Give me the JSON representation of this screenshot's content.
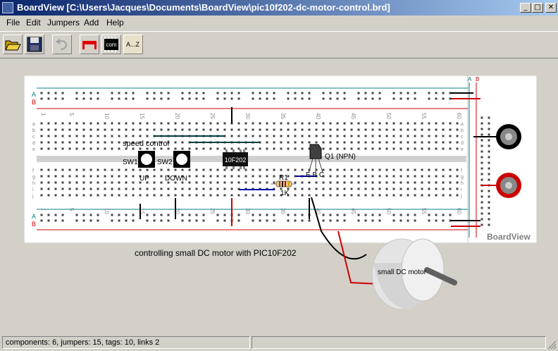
{
  "window": {
    "title": "BoardView  [C:\\Users\\Jacques\\Documents\\BoardView\\pic10f202-dc-motor-control.brd]",
    "minimize_glyph": "_",
    "maximize_glyph": "□",
    "close_glyph": "✕"
  },
  "menu": [
    {
      "label": "File"
    },
    {
      "label": "Edit"
    },
    {
      "label": "Jumpers"
    },
    {
      "label": "Add"
    },
    {
      "label": "Help"
    }
  ],
  "toolbar": {
    "open_icon": "open-folder-icon",
    "save_icon": "save-disk-icon",
    "undo_icon": "undo-icon",
    "jumper_icon": "red-jumper-icon",
    "chip_label": "com",
    "labels_label": "A...Z"
  },
  "board": {
    "rail_top": [
      "A",
      "B"
    ],
    "rail_bottom": [
      "A",
      "B"
    ],
    "rows_top": [
      "a",
      "b",
      "c",
      "d",
      "e"
    ],
    "rows_bottom": [
      "f",
      "g",
      "h",
      "i",
      "j"
    ],
    "column_numbers": [
      "1",
      "5",
      "10",
      "15",
      "20",
      "25",
      "30",
      "35",
      "40",
      "45",
      "50",
      "55",
      "60"
    ],
    "brand": "BoardView",
    "components": {
      "speed_label": "speed control",
      "sw1": "SW1",
      "sw2": "SW2",
      "up": "UP",
      "down": "DOWN",
      "ic_label": "10F202",
      "q1": "Q1 (NPN)",
      "ebc": "E B C",
      "r1": "R1",
      "r1_value": "1K"
    },
    "colors": {
      "rail_a": "#008080",
      "rail_b": "#cc0000",
      "jumper_black": "#000000",
      "jumper_red": "#cc0000",
      "jumper_blue": "#0000aa"
    }
  },
  "caption": "controlling small DC motor with PIC10F202",
  "motor_label": "small DC motor",
  "status": {
    "summary": "components: 6, jumpers: 15, tags: 10, links 2"
  }
}
